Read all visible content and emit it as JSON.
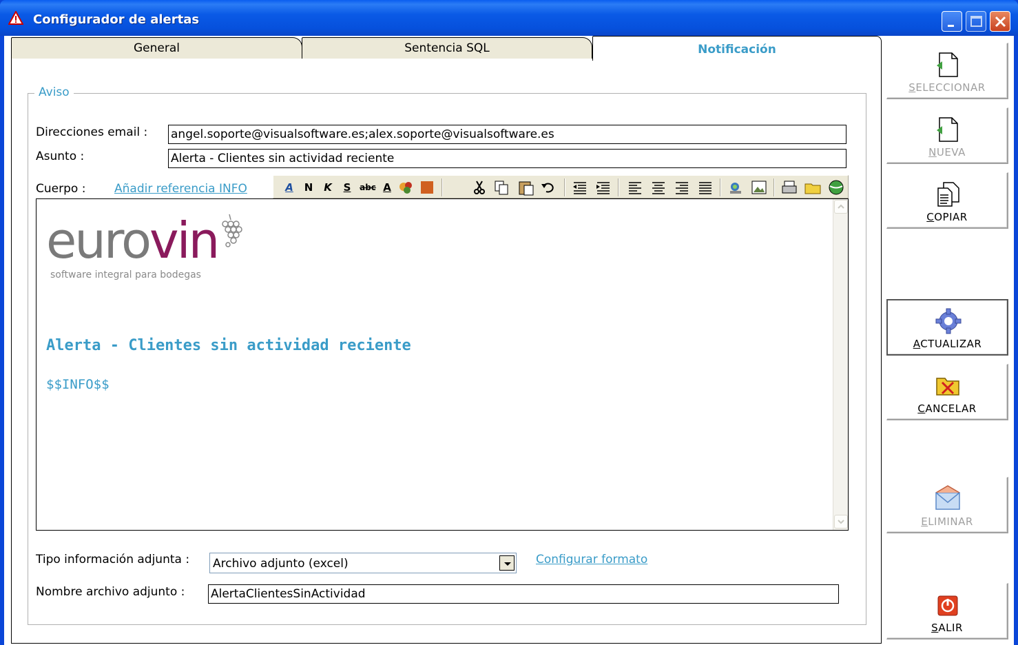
{
  "window": {
    "title": "Configurador de alertas"
  },
  "tabs": [
    {
      "label": "General"
    },
    {
      "label": "Sentencia SQL"
    },
    {
      "label": "Notificación",
      "active": true
    }
  ],
  "aviso": {
    "legend": "Aviso",
    "email_label": "Direcciones email :",
    "email_value": "angel.soporte@visualsoftware.es;alex.soporte@visualsoftware.es",
    "subject_label": "Asunto :",
    "subject_value": "Alerta - Clientes sin actividad reciente",
    "body_label": "Cuerpo :",
    "add_ref_link": "Añadir referencia INFO"
  },
  "editor": {
    "logo_euro": "euro",
    "logo_vin": "vin",
    "logo_sub": "software integral para bodegas",
    "heading": "Alerta - Clientes sin actividad reciente",
    "placeholder_token": "$$INFO$$",
    "toolbar": {
      "bold": "N",
      "italic": "K",
      "underline": "S",
      "strike": "abc",
      "font_color": "A"
    }
  },
  "attachment": {
    "type_label": "Tipo información adjunta :",
    "type_value": "Archivo adjunto (excel)",
    "format_link": "Configurar formato",
    "filename_label": "Nombre archivo adjunto :",
    "filename_value": "AlertaClientesSinActividad"
  },
  "side_buttons": {
    "seleccionar": {
      "mnemonic": "S",
      "rest": "ELECCIONAR"
    },
    "nueva": {
      "mnemonic": "N",
      "rest": "UEVA"
    },
    "copiar": {
      "mnemonic": "C",
      "rest": "OPIAR"
    },
    "actualizar": {
      "mnemonic": "A",
      "rest": "CTUALIZAR"
    },
    "cancelar": {
      "mnemonic": "C",
      "rest": "ANCELAR"
    },
    "eliminar": {
      "mnemonic": "E",
      "rest": "LIMINAR"
    },
    "salir": {
      "mnemonic": "S",
      "rest": "ALIR"
    }
  },
  "colors": {
    "accent": "#3a9cc8",
    "logo_grey": "#7a7a7a",
    "logo_wine": "#8a1a5c",
    "titlebar": "#0a5ae6"
  }
}
